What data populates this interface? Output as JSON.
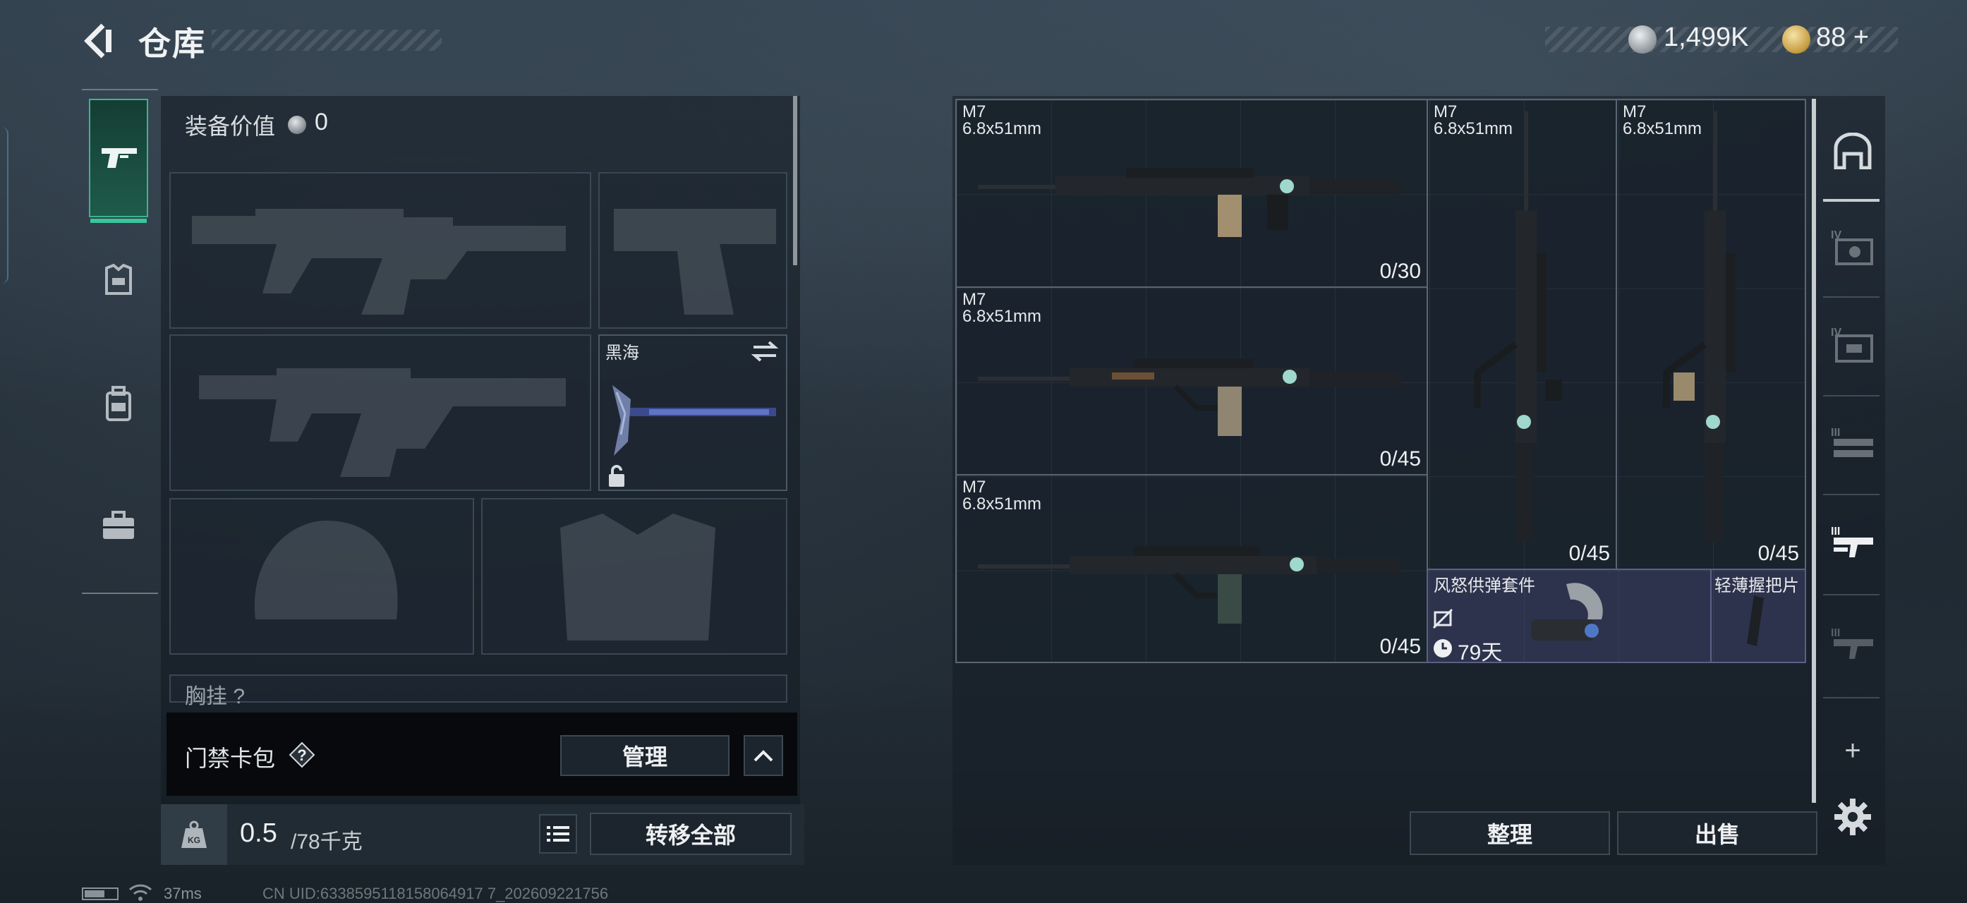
{
  "header": {
    "title": "仓库",
    "back_icon": "back-arrow-icon",
    "currency": {
      "silver_value": "1,499K",
      "gold_value": "88",
      "gold_add": "+",
      "silver_color": "#b7bcc1",
      "gold_color": "#c49a3d"
    }
  },
  "left_nav": {
    "tabs": [
      {
        "icon": "gun-icon",
        "active": true
      },
      {
        "icon": "armor-icon",
        "active": false
      },
      {
        "icon": "backpack-icon",
        "active": false
      },
      {
        "icon": "briefcase-icon",
        "active": false
      }
    ],
    "accent_color": "#37c79c"
  },
  "loadout": {
    "equip_value_label": "装备价值",
    "equip_value": "0",
    "melee_slot_label": "黑海",
    "rig_label": "胸挂",
    "rig_help": "?"
  },
  "keycard": {
    "label": "门禁卡包",
    "help": "?",
    "manage_label": "管理"
  },
  "capacity": {
    "current": "0.5",
    "max": "/78千克",
    "kg_icon": "KG",
    "transfer_label": "转移全部"
  },
  "status": {
    "ping": "37ms",
    "uid": "CN UID:6338595118158064917 7_202609221756"
  },
  "storage": {
    "weapons": [
      {
        "name": "M7",
        "caliber": "6.8x51mm",
        "ammo": "0/30"
      },
      {
        "name": "M7",
        "caliber": "6.8x51mm",
        "ammo": "0/45"
      },
      {
        "name": "M7",
        "caliber": "6.8x51mm",
        "ammo": "0/45"
      },
      {
        "name": "M7",
        "caliber": "6.8x51mm",
        "ammo": "0/45"
      },
      {
        "name": "M7",
        "caliber": "6.8x51mm",
        "ammo": "0/45"
      }
    ],
    "attachments": [
      {
        "name": "风怒供弹套件",
        "days": "79天"
      },
      {
        "name": "轻薄握把片"
      }
    ]
  },
  "right_tabs": {
    "tab_labels": [
      "IV",
      "IV",
      "III",
      "III",
      "III"
    ],
    "add_label": "+"
  },
  "actions": {
    "sort_label": "整理",
    "sell_label": "出售"
  }
}
